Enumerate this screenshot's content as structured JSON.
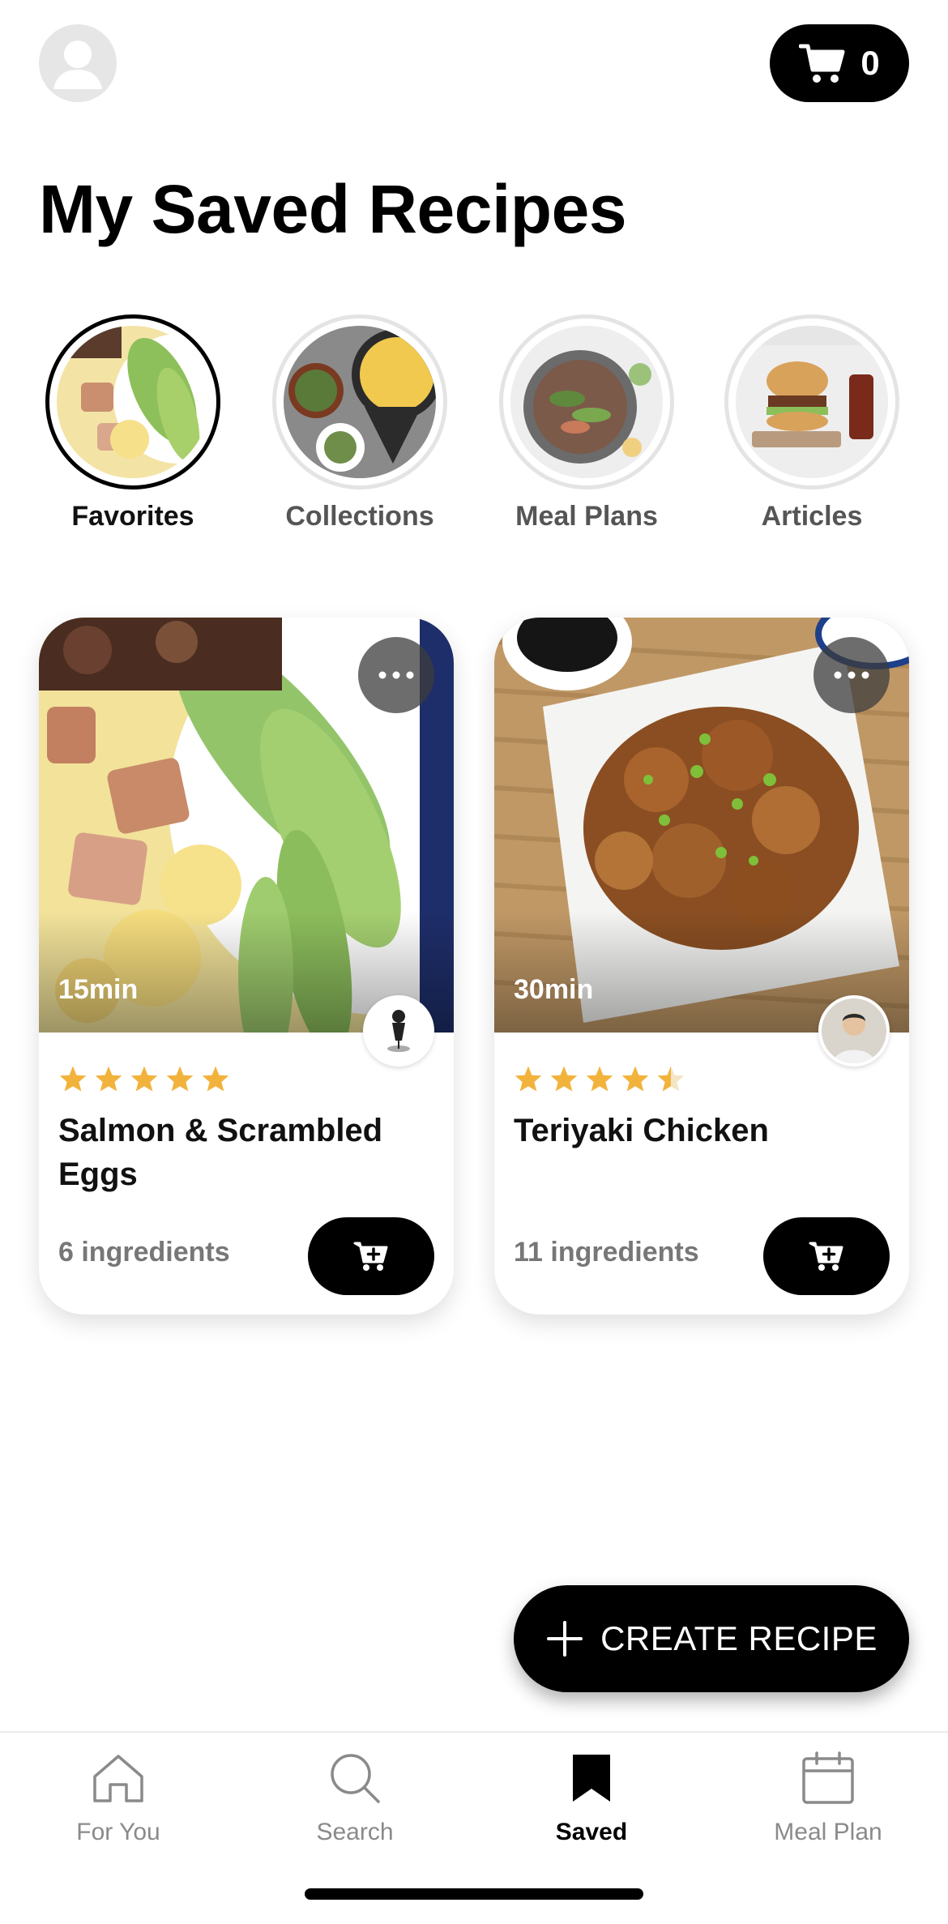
{
  "header": {
    "avatar_icon": "user-avatar-icon",
    "cart_icon": "shopping-cart-icon",
    "cart_count": "0"
  },
  "page": {
    "title": "My Saved Recipes"
  },
  "categories": [
    {
      "label": "Favorites",
      "active": true
    },
    {
      "label": "Collections",
      "active": false
    },
    {
      "label": "Meal Plans",
      "active": false
    },
    {
      "label": "Articles",
      "active": false
    }
  ],
  "recipes": [
    {
      "time": "15min",
      "title": "Salmon & Scrambled Eggs",
      "rating": 5,
      "ingredients": "6 ingredients"
    },
    {
      "time": "30min",
      "title": "Teriyaki Chicken",
      "rating": 4.5,
      "ingredients": "11 ingredients"
    }
  ],
  "fab": {
    "label": "CREATE RECIPE",
    "icon": "plus-icon"
  },
  "nav": [
    {
      "label": "For You",
      "icon": "home-icon",
      "active": false
    },
    {
      "label": "Search",
      "icon": "search-icon",
      "active": false
    },
    {
      "label": "Saved",
      "icon": "bookmark-icon",
      "active": true
    },
    {
      "label": "Meal Plan",
      "icon": "calendar-icon",
      "active": false
    }
  ],
  "colors": {
    "accent": "#000000",
    "star": "#F2B33D",
    "muted_text": "#777777",
    "background": "#FFFFFF"
  }
}
